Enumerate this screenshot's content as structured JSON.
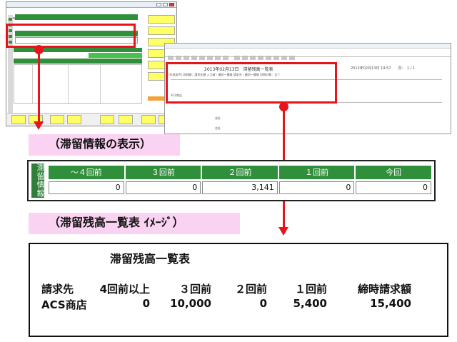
{
  "colors": {
    "highlight_red": "#e8141b",
    "caption_pink": "#fbd3f2",
    "header_green": "#2f8f3a",
    "side_green": "#2f7f3a"
  },
  "captions": {
    "stay_info": "（滞留情報の表示）",
    "report_image": "（滞留残高一覧表 ｲﾒｰｼﾞ）"
  },
  "stay_panel": {
    "side_label": "滞留情報",
    "headers": [
      "～４回前",
      "３回前",
      "２回前",
      "１回前",
      "今回"
    ],
    "values": [
      "0",
      "0",
      "3,141",
      "0",
      "0"
    ]
  },
  "report": {
    "title": "滞留残高一覧表",
    "columns": [
      "請求先",
      "4回前以上",
      "３回前",
      "２回前",
      "１回前",
      "締時請求額"
    ],
    "row": [
      "ACS商店",
      "0",
      "10,000",
      "0",
      "5,400",
      "15,400"
    ]
  },
  "preview": {
    "doc_title": "2013年02月13日　滞留残高一覧表",
    "doc_date": "2013年02月13日 19:57　　頁：　1 / 1",
    "doc_sub": "(作成条件) 印刷順：請求先順 入力者・最初～最後 請求先・最初～最後 印刷対象：全て",
    "rows": [
      "ACS商店",
      "合計",
      "合計"
    ]
  }
}
